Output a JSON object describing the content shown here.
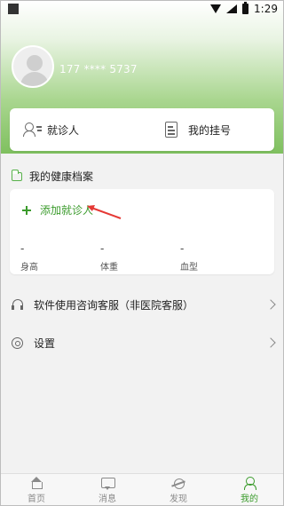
{
  "status_bar": {
    "time": "1:29"
  },
  "profile": {
    "phone": "177 **** 5737"
  },
  "quick_actions": [
    {
      "label": "就诊人",
      "icon": "patient-icon"
    },
    {
      "label": "我的挂号",
      "icon": "registration-icon"
    }
  ],
  "health_record": {
    "title": "我的健康档案",
    "add_label": "添加就诊人",
    "metrics": [
      {
        "value": "-",
        "label": "身高"
      },
      {
        "value": "-",
        "label": "体重"
      },
      {
        "value": "-",
        "label": "血型"
      }
    ]
  },
  "menu": [
    {
      "label": "软件使用咨询客服（非医院客服）",
      "icon": "headset-icon"
    },
    {
      "label": "设置",
      "icon": "gear-icon"
    }
  ],
  "tabs": [
    {
      "label": "首页",
      "icon": "home-icon"
    },
    {
      "label": "消息",
      "icon": "message-icon"
    },
    {
      "label": "发现",
      "icon": "discover-icon"
    },
    {
      "label": "我的",
      "icon": "me-icon"
    }
  ],
  "colors": {
    "accent_green": "#3b9b2c",
    "hero_green": "#7fc05f",
    "arrow_red": "#e53935"
  }
}
